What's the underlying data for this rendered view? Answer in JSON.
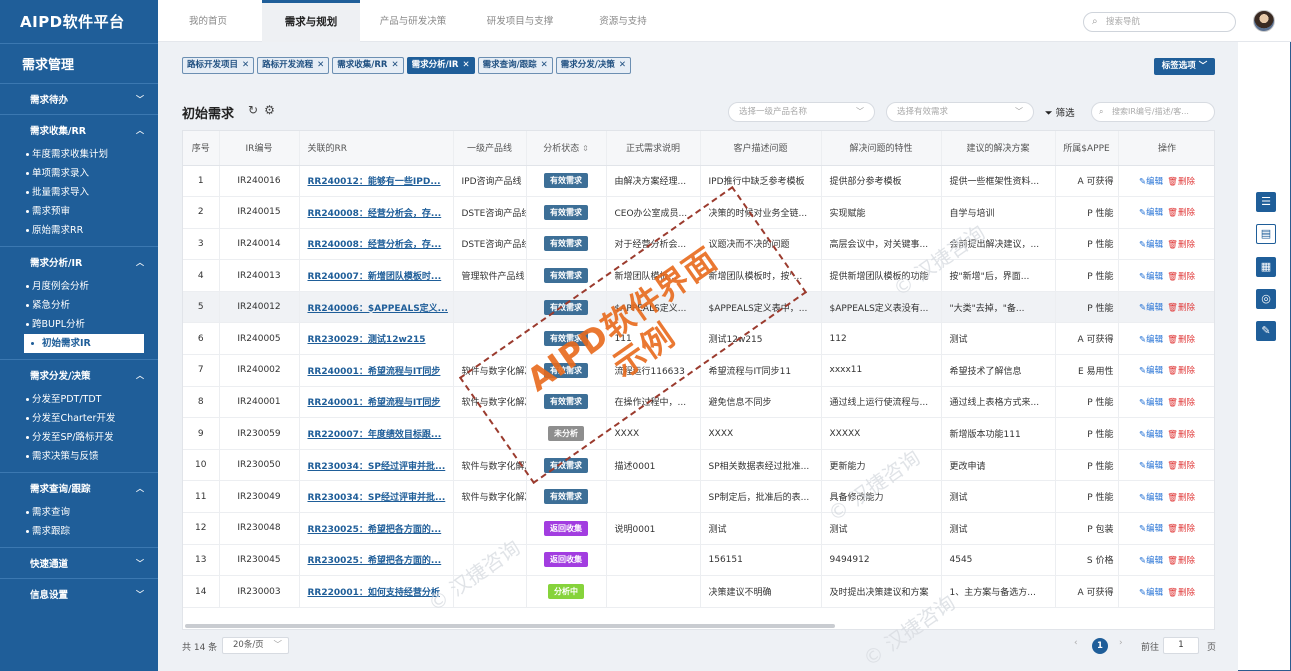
{
  "app": {
    "title": "AIPD软件平台",
    "module": "需求管理"
  },
  "sidebar": {
    "groups": [
      {
        "label": "需求待办",
        "items": []
      },
      {
        "label": "需求收集/RR",
        "items": [
          "年度需求收集计划",
          "单项需求录入",
          "批量需求导入",
          "需求预审",
          "原始需求RR"
        ]
      },
      {
        "label": "需求分析/IR",
        "items": [
          "月度例会分析",
          "紧急分析",
          "跨BUPL分析",
          "初始需求IR"
        ]
      },
      {
        "label": "需求分发/决策",
        "items": [
          "分发至PDT/TDT",
          "分发至Charter开发",
          "分发至SP/路标开发",
          "需求决策与反馈"
        ]
      },
      {
        "label": "需求查询/跟踪",
        "items": [
          "需求查询",
          "需求跟踪"
        ]
      },
      {
        "label": "快速通道",
        "items": []
      },
      {
        "label": "信息设置",
        "items": []
      }
    ]
  },
  "topnav": {
    "tabs": [
      "我的首页",
      "需求与规划",
      "产品与研发决策",
      "研发项目与支撑",
      "资源与支持"
    ],
    "search_placeholder": "搜索导航"
  },
  "chips": [
    "路标开发项目",
    "路标开发流程",
    "需求收集/RR",
    "需求分析/IR",
    "需求查询/跟踪",
    "需求分发/决策"
  ],
  "tag_options_label": "标签选项",
  "page": {
    "title": "初始需求",
    "select1_placeholder": "选择一级产品名称",
    "select2_placeholder": "选择有效需求",
    "filter_label": "筛选",
    "search_placeholder": "搜索IR编号/描述/客..."
  },
  "table": {
    "columns": [
      "序号",
      "IR编号",
      "关联的RR",
      "一级产品线",
      "分析状态",
      "正式需求说明",
      "客户描述问题",
      "解决问题的特性",
      "建议的解决方案",
      "所属$APPE",
      "操作"
    ],
    "rows": [
      [
        "1",
        "IR240016",
        "RR240012：能够有一些IPD...",
        "IPD咨询产品线",
        "有效需求",
        "由解决方案经理...",
        "IPD推行中缺乏参考模板",
        "提供部分参考模板",
        "提供一些框架性资料...",
        "A 可获得"
      ],
      [
        "2",
        "IR240015",
        "RR240008：经营分析会，存...",
        "DSTE咨询产品线",
        "有效需求",
        "CEO办公室成员...",
        "决策的时候对业务全链...",
        "实现赋能",
        "自学与培训",
        "P 性能"
      ],
      [
        "3",
        "IR240014",
        "RR240008：经营分析会，存...",
        "DSTE咨询产品线",
        "有效需求",
        "对于经营分析会...",
        "议题决而不决的问题",
        "高层会议中，对关键事...",
        "会前提出解决建议，...",
        "P 性能"
      ],
      [
        "4",
        "IR240013",
        "RR240007：新增团队模板时...",
        "管理软件产品线",
        "有效需求",
        "新增团队模板...",
        "新增团队模板时，按\"...",
        "提供新增团队模板的功能",
        "按\"新增\"后，界面...",
        "P 性能"
      ],
      [
        "5",
        "IR240012",
        "RR240006：$APPEALS定义...",
        "",
        "有效需求",
        "$APPEALS定义...",
        "$APPEALS定义表中，...",
        "$APPEALS定义表没有...",
        "\"大类\"去掉，\"备...",
        "P 性能"
      ],
      [
        "6",
        "IR240005",
        "RR230029：测试12w215",
        "",
        "有效需求",
        "111",
        "测试12w215",
        "112",
        "测试",
        "A 可获得"
      ],
      [
        "7",
        "IR240002",
        "RR240001：希望流程与IT同步",
        "软件与数字化解决",
        "有效需求",
        "流程运行116633",
        "希望流程与IT同步11",
        "xxxx11",
        "希望技术了解信息",
        "E 易用性"
      ],
      [
        "8",
        "IR240001",
        "RR240001：希望流程与IT同步",
        "软件与数字化解决",
        "有效需求",
        "在操作过程中，...",
        "避免信息不同步",
        "通过线上运行使流程与...",
        "通过线上表格方式来...",
        "P 性能"
      ],
      [
        "9",
        "IR230059",
        "RR220007：年度绩效目标跟...",
        "",
        "未分析",
        "XXXX",
        "XXXX",
        "XXXXX",
        "新增版本功能111",
        "P 性能"
      ],
      [
        "10",
        "IR230050",
        "RR230034：SP经过评审并批...",
        "软件与数字化解决",
        "有效需求",
        "描述0001",
        "SP相关数据表经过批准...",
        "更新能力",
        "更改申请",
        "P 性能"
      ],
      [
        "11",
        "IR230049",
        "RR230034：SP经过评审并批...",
        "软件与数字化解决",
        "有效需求",
        "",
        "SP制定后，批准后的表...",
        "具备修改能力",
        "测试",
        "P 性能"
      ],
      [
        "12",
        "IR230048",
        "RR230025：希望把各方面的...",
        "",
        "返回收集",
        "说明0001",
        "测试",
        "测试",
        "测试",
        "P 包装"
      ],
      [
        "13",
        "IR230045",
        "RR230025：希望把各方面的...",
        "",
        "返回收集",
        "",
        "156151",
        "9494912",
        "4545",
        "S 价格"
      ],
      [
        "14",
        "IR230003",
        "RR220001：如何支持经营分析",
        "",
        "分析中",
        "",
        "决策建议不明确",
        "及时提出决策建议和方案",
        "1、主方案与备选方...",
        "A 可获得"
      ]
    ],
    "edit_label": "编辑",
    "delete_label": "删除"
  },
  "status_colors": {
    "有效需求": "#3d6f97",
    "未分析": "#8e8e8e",
    "返回收集": "#a23de0",
    "分析中": "#86d33b"
  },
  "pager": {
    "total": "共 14 条",
    "page_size": "20条/页",
    "current": "1",
    "goto_label": "前往",
    "goto_value": "1",
    "page_suffix": "页"
  },
  "watermark": {
    "stamp_line1": "AIPD软件界面",
    "stamp_line2": "示例",
    "faint_text": "© 汉捷咨询"
  },
  "right_toolbar": [
    "list-icon",
    "document-icon",
    "grid-icon",
    "chat-icon",
    "feedback-icon"
  ]
}
